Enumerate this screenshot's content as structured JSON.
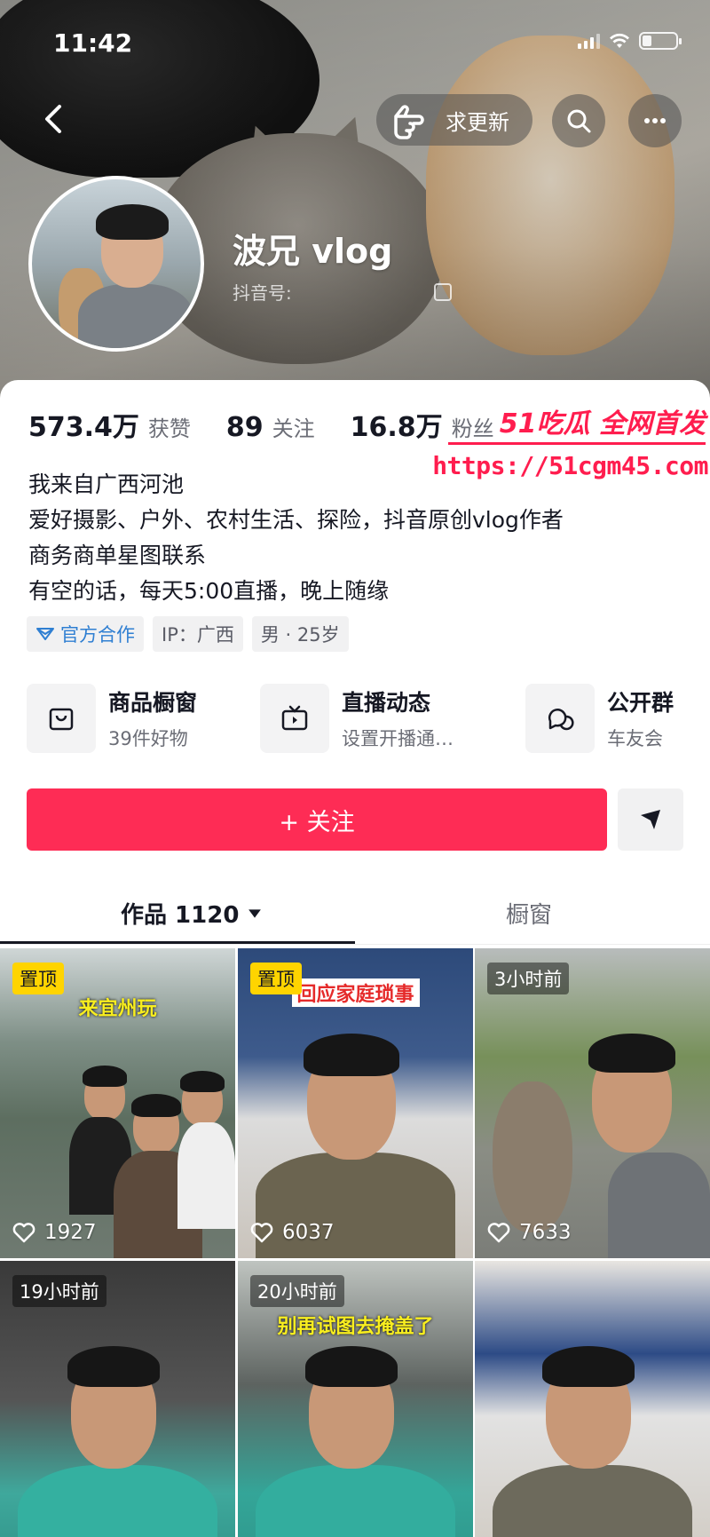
{
  "status_bar": {
    "time": "11:42"
  },
  "header": {
    "update_label": "求更新",
    "nickname": "波兄 vlog",
    "douyin_id_label": "抖音号:"
  },
  "stats": [
    {
      "value": "573.4万",
      "label": "获赞"
    },
    {
      "value": "89",
      "label": "关注"
    },
    {
      "value": "16.8万",
      "label": "粉丝"
    }
  ],
  "watermark": {
    "title": "51吃瓜 全网首发",
    "url": "https://51cgm45.com"
  },
  "bio": [
    "我来自广西河池",
    " 爱好摄影、户外、农村生活、探险，抖音原创vlog作者",
    " 商务商单星图联系",
    "有空的话，每天5:00直播，晚上随缘"
  ],
  "tags": [
    "官方合作",
    "IP：广西",
    "男 · 25岁"
  ],
  "services": [
    {
      "title": "商品橱窗",
      "subtitle": "39件好物",
      "icon": "shopping-bag-icon"
    },
    {
      "title": "直播动态",
      "subtitle": "设置开播通…",
      "icon": "tv-icon"
    },
    {
      "title": "公开群",
      "subtitle": "车友会",
      "icon": "chat-bubbles-icon"
    }
  ],
  "follow_label": "+ 关注",
  "tabs": {
    "works": "作品 1120",
    "showcase": "橱窗"
  },
  "videos": [
    {
      "badge": "置顶",
      "badge_type": "pin",
      "caption": "来宜州玩",
      "likes": "1927"
    },
    {
      "badge": "置顶",
      "badge_type": "pin",
      "caption": "回应家庭琐事",
      "likes": "6037"
    },
    {
      "badge": "3小时前",
      "badge_type": "time",
      "caption": "",
      "likes": "7633"
    },
    {
      "badge": "19小时前",
      "badge_type": "time",
      "caption": "",
      "likes": ""
    },
    {
      "badge": "20小时前",
      "badge_type": "time",
      "caption": "别再试图去掩盖了",
      "likes": ""
    },
    {
      "badge": "",
      "badge_type": "none",
      "caption": "",
      "likes": ""
    }
  ],
  "colors": {
    "accent": "#fe2c55",
    "pin": "#ffd400",
    "official": "#2f7fd2"
  }
}
